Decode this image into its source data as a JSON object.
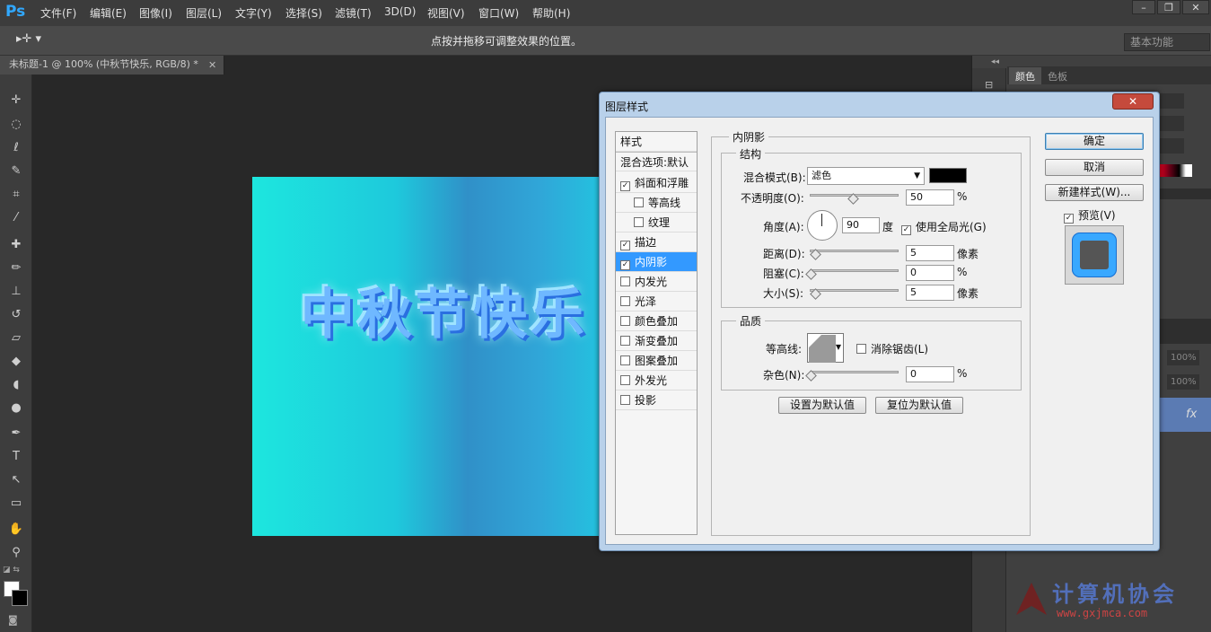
{
  "app": {
    "logo": "Ps"
  },
  "menu": [
    "文件(F)",
    "编辑(E)",
    "图像(I)",
    "图层(L)",
    "文字(Y)",
    "选择(S)",
    "滤镜(T)",
    "3D(D)",
    "视图(V)",
    "窗口(W)",
    "帮助(H)"
  ],
  "window_buttons": [
    "–",
    "❐",
    "✕"
  ],
  "options": {
    "hint": "点按并拖移可调整效果的位置。",
    "workspace": "基本功能"
  },
  "document": {
    "tab": "未标题-1 @ 100% (中秋节快乐, RGB/8) *",
    "canvas_text": "中秋节快乐"
  },
  "right_panel": {
    "tabs": [
      "颜色",
      "色板"
    ],
    "percent1": "100%",
    "percent2": "100%",
    "fx": "fx"
  },
  "dialog": {
    "title": "图层样式",
    "close": "✕",
    "styles_header": "样式",
    "blend_options": "混合选项:默认",
    "styles": [
      {
        "label": "斜面和浮雕",
        "checked": true,
        "indent": false,
        "selected": false
      },
      {
        "label": "等高线",
        "checked": false,
        "indent": true,
        "selected": false
      },
      {
        "label": "纹理",
        "checked": false,
        "indent": true,
        "selected": false
      },
      {
        "label": "描边",
        "checked": true,
        "indent": false,
        "selected": false
      },
      {
        "label": "内阴影",
        "checked": true,
        "indent": false,
        "selected": true
      },
      {
        "label": "内发光",
        "checked": false,
        "indent": false,
        "selected": false
      },
      {
        "label": "光泽",
        "checked": false,
        "indent": false,
        "selected": false
      },
      {
        "label": "颜色叠加",
        "checked": false,
        "indent": false,
        "selected": false
      },
      {
        "label": "渐变叠加",
        "checked": false,
        "indent": false,
        "selected": false
      },
      {
        "label": "图案叠加",
        "checked": false,
        "indent": false,
        "selected": false
      },
      {
        "label": "外发光",
        "checked": false,
        "indent": false,
        "selected": false
      },
      {
        "label": "投影",
        "checked": false,
        "indent": false,
        "selected": false
      }
    ],
    "section_title": "内阴影",
    "structure_title": "结构",
    "blend_mode_label": "混合模式(B):",
    "blend_mode_value": "滤色",
    "opacity_label": "不透明度(O):",
    "opacity_value": "50",
    "opacity_unit": "%",
    "opacity_level": 0.5,
    "angle_label": "角度(A):",
    "angle_value": "90",
    "angle_unit": "度",
    "global_light_label": "使用全局光(G)",
    "global_light_checked": true,
    "distance_label": "距离(D):",
    "distance_value": "5",
    "distance_unit": "像素",
    "choke_label": "阻塞(C):",
    "choke_value": "0",
    "choke_unit": "%",
    "size_label": "大小(S):",
    "size_value": "5",
    "size_unit": "像素",
    "quality_title": "品质",
    "contour_label": "等高线:",
    "antialias_label": "消除锯齿(L)",
    "noise_label": "杂色(N):",
    "noise_value": "0",
    "noise_unit": "%",
    "set_default": "设置为默认值",
    "reset_default": "复位为默认值",
    "ok": "确定",
    "cancel": "取消",
    "new_style": "新建样式(W)...",
    "preview_label": "预览(V)",
    "preview_checked": true
  },
  "watermark": {
    "text": "计算机协会",
    "url": "www.gxjmca.com"
  },
  "colors": {
    "accent": "#3399ff",
    "canvas_left": "#1de6de",
    "canvas_mid": "#3090c8"
  }
}
